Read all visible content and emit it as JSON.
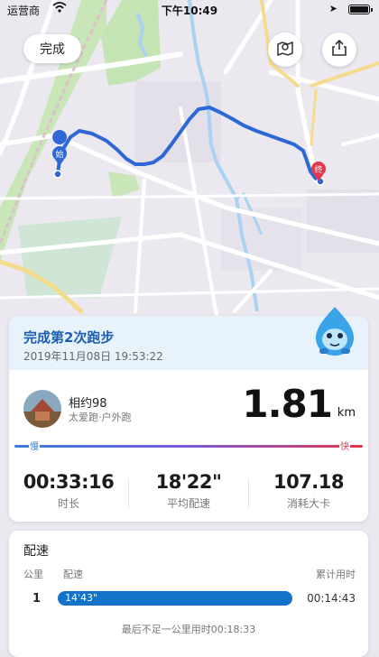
{
  "status_bar": {
    "carrier": "运营商",
    "time": "下午10:49"
  },
  "header": {
    "done_label": "完成"
  },
  "route": {
    "start_label": "始",
    "end_label": "终",
    "route_color": "#2d68d6",
    "end_color": "#e2384a"
  },
  "summary": {
    "title": "完成第2次跑步",
    "date": "2019年11月08日 19:53:22",
    "user_name": "相约98",
    "user_sub": "太爱跑·户外跑",
    "distance": "1.81",
    "distance_unit": "km",
    "slow_label": "慢",
    "fast_label": "快",
    "stats": [
      {
        "value": "00:33:16",
        "label": "时长"
      },
      {
        "value": "18'22\"",
        "label": "平均配速"
      },
      {
        "value": "107.18",
        "label": "消耗大卡"
      }
    ]
  },
  "pace": {
    "title": "配速",
    "col_km": "公里",
    "col_pace": "配速",
    "col_total": "累计用时",
    "rows": [
      {
        "km": "1",
        "pace": "14'43\"",
        "total": "00:14:43"
      }
    ],
    "footer": "最后不足一公里用时00:18:33"
  },
  "colors": {
    "accent": "#1373c9",
    "title_blue": "#1a5fb4",
    "slow": "#3b7fd8",
    "fast": "#e2384a"
  }
}
